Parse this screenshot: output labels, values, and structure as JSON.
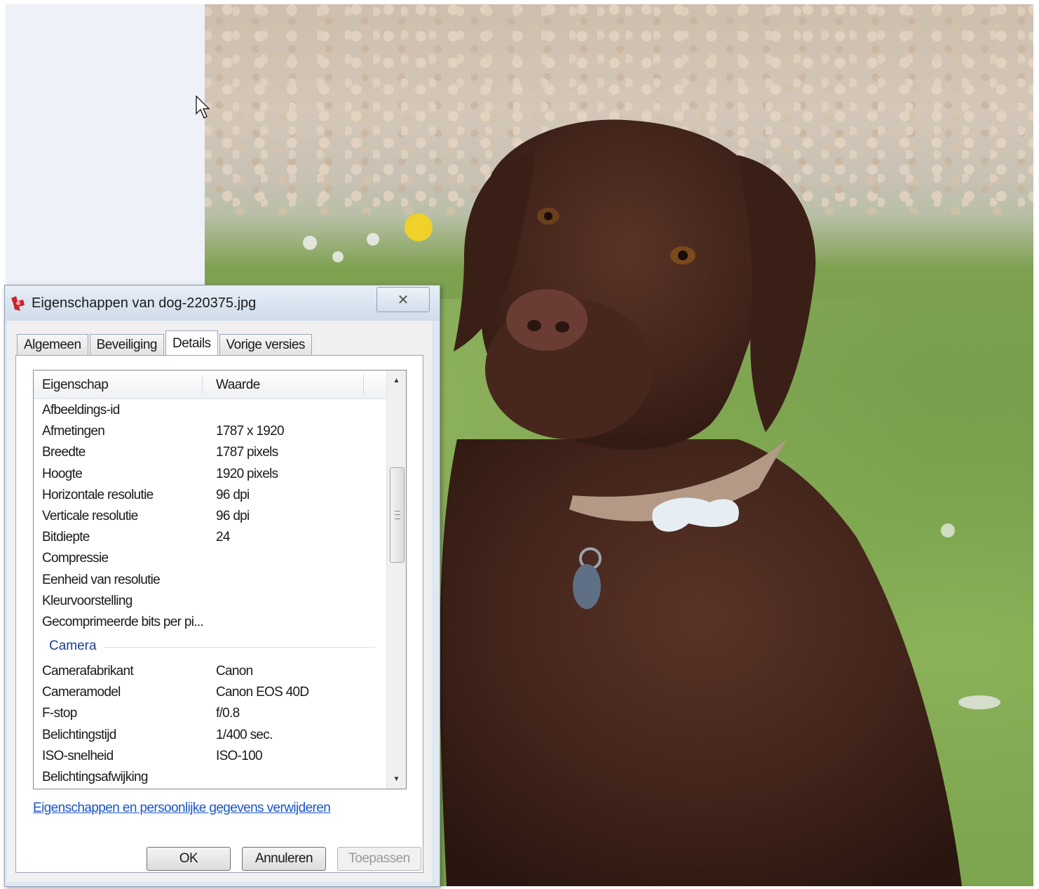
{
  "window": {
    "title": "Eigenschappen van dog-220375.jpg",
    "close_symbol": "✕"
  },
  "tabs": [
    {
      "label": "Algemeen",
      "active": false
    },
    {
      "label": "Beveiliging",
      "active": false
    },
    {
      "label": "Details",
      "active": true
    },
    {
      "label": "Vorige versies",
      "active": false
    }
  ],
  "list": {
    "headers": {
      "property": "Eigenschap",
      "value": "Waarde"
    },
    "rows_image": [
      {
        "key": "Afbeeldings-id",
        "value": ""
      },
      {
        "key": "Afmetingen",
        "value": "1787 x 1920"
      },
      {
        "key": "Breedte",
        "value": "1787 pixels"
      },
      {
        "key": "Hoogte",
        "value": "1920 pixels"
      },
      {
        "key": "Horizontale resolutie",
        "value": "96 dpi"
      },
      {
        "key": "Verticale resolutie",
        "value": "96 dpi"
      },
      {
        "key": "Bitdiepte",
        "value": "24"
      },
      {
        "key": "Compressie",
        "value": ""
      },
      {
        "key": "Eenheid van resolutie",
        "value": ""
      },
      {
        "key": "Kleurvoorstelling",
        "value": ""
      },
      {
        "key": "Gecomprimeerde bits per pi...",
        "value": ""
      }
    ],
    "group_camera": "Camera",
    "rows_camera": [
      {
        "key": "Camerafabrikant",
        "value": "Canon"
      },
      {
        "key": "Cameramodel",
        "value": "Canon EOS 40D"
      },
      {
        "key": "F-stop",
        "value": "f/0.8"
      },
      {
        "key": "Belichtingstijd",
        "value": "1/400 sec."
      },
      {
        "key": "ISO-snelheid",
        "value": "ISO-100"
      },
      {
        "key": "Belichtingsafwijking",
        "value": ""
      }
    ]
  },
  "remove_link": "Eigenschappen en persoonlijke gegevens verwijderen",
  "buttons": {
    "ok": "OK",
    "cancel": "Annuleren",
    "apply": "Toepassen"
  },
  "colors": {
    "link": "#1a55c8",
    "group_header": "#1e3f8e"
  },
  "icons": {
    "title": "properties-icon",
    "cursor": "mouse-pointer-icon"
  }
}
